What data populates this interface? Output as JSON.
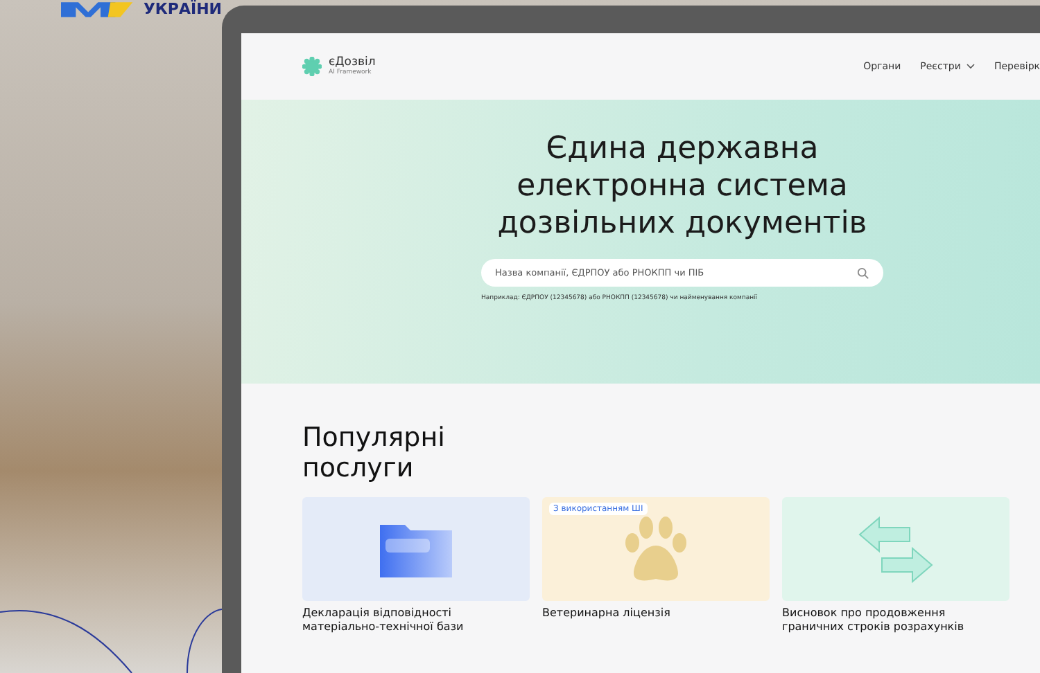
{
  "logo": {
    "text": "УКРАЇНИ"
  },
  "site": {
    "brand": "єДозвіл",
    "subtitle": "AI Framework",
    "nav": [
      {
        "label": "Органи",
        "dropdown": false
      },
      {
        "label": "Реєстри",
        "dropdown": true
      },
      {
        "label": "Перевірк",
        "dropdown": false
      }
    ]
  },
  "hero": {
    "title_lines": [
      "Єдина державна",
      "електронна система",
      "дозвільних документів"
    ],
    "search": {
      "placeholder": "Назва компанії, ЄДРПОУ або РНОКПП чи ПІБ"
    },
    "hint": "Наприклад: ЄДРПОУ (12345678) або РНОКПП (12345678) чи найменування компанії"
  },
  "popular": {
    "title_lines": [
      "Популярні",
      "послуги"
    ],
    "cards": [
      {
        "kind": "folder",
        "title": "Декларація відповідності матеріально-технічної бази"
      },
      {
        "kind": "paw",
        "title": "Ветеринарна ліцензія",
        "badge": "З використанням ШІ"
      },
      {
        "kind": "arrows",
        "title": "Висновок про продовження граничних строків розрахунків"
      }
    ]
  }
}
